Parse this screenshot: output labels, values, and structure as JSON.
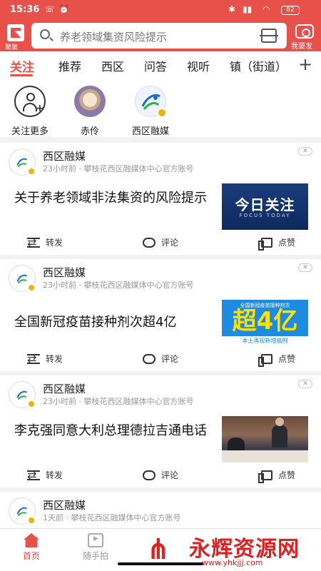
{
  "status": {
    "time": "15:36",
    "battery": "82"
  },
  "header": {
    "logo_label": "聚聚",
    "search_placeholder": "养老领域集资风险提示",
    "camera_label": "我要发"
  },
  "tabs": [
    {
      "label": "关注",
      "active": true
    },
    {
      "label": "推荐"
    },
    {
      "label": "西区"
    },
    {
      "label": "问答"
    },
    {
      "label": "视听"
    },
    {
      "label": "镇（街道）"
    }
  ],
  "follow": {
    "items": [
      {
        "label": "关注更多"
      },
      {
        "label": "赤伶"
      },
      {
        "label": "西区融媒"
      }
    ]
  },
  "feed": [
    {
      "account": "西区融媒",
      "meta": "23小时前 · 攀枝花西区融媒体中心官方账号",
      "title": "关于养老领域非法集资的风险提示",
      "thumb_big": "今日关注",
      "thumb_sub": "FOCUS TODAY",
      "actions": [
        "转发",
        "评论",
        "点赞"
      ]
    },
    {
      "account": "西区融媒",
      "meta": "23小时前 · 攀枝花西区融媒体中心官方账号",
      "title": "全国新冠疫苗接种剂次超4亿",
      "thumb_top": "全国新冠疫苗接种剂次",
      "thumb_big": "超4亿",
      "thumb_foot": "本土再现新增病例",
      "actions": [
        "转发",
        "评论",
        "点赞"
      ]
    },
    {
      "account": "西区融媒",
      "meta": "23小时前 · 攀枝花西区融媒体中心官方账号",
      "title": "李克强同意大利总理德拉吉通电话",
      "actions": [
        "转发",
        "评论",
        "点赞"
      ]
    },
    {
      "account": "西区融媒",
      "meta": "1天前 · 攀枝花西区融媒体中心官方账号"
    }
  ],
  "bottom_nav": [
    {
      "label": "首页",
      "active": true
    },
    {
      "label": "随手拍"
    }
  ],
  "watermark": {
    "text": "永辉资源网",
    "url": "www.yhkjjj.com"
  },
  "colors": {
    "accent": "#e8504a",
    "badge": "#f0b400"
  }
}
